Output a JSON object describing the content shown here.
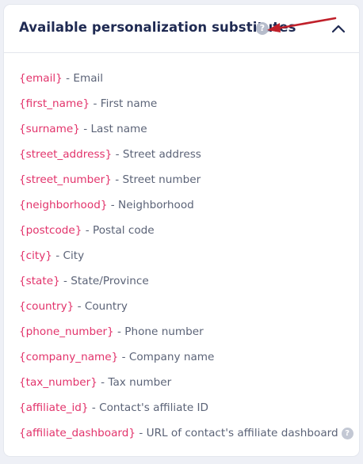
{
  "panel": {
    "title": "Available personalization substitutes",
    "help_glyph": "?",
    "toggle_icon": "chevron-up-icon",
    "annotation_color": "#c0202a"
  },
  "items": [
    {
      "token": "{email}",
      "separator": " - ",
      "description": "Email"
    },
    {
      "token": "{first_name}",
      "separator": " - ",
      "description": "First name"
    },
    {
      "token": "{surname}",
      "separator": " - ",
      "description": "Last name"
    },
    {
      "token": "{street_address}",
      "separator": " - ",
      "description": "Street address"
    },
    {
      "token": "{street_number}",
      "separator": " - ",
      "description": "Street number"
    },
    {
      "token": "{neighborhood}",
      "separator": " - ",
      "description": "Neighborhood"
    },
    {
      "token": "{postcode}",
      "separator": " - ",
      "description": "Postal code"
    },
    {
      "token": "{city}",
      "separator": " - ",
      "description": "City"
    },
    {
      "token": "{state}",
      "separator": " - ",
      "description": "State/Province"
    },
    {
      "token": "{country}",
      "separator": " - ",
      "description": "Country"
    },
    {
      "token": "{phone_number}",
      "separator": " - ",
      "description": "Phone number"
    },
    {
      "token": "{company_name}",
      "separator": " - ",
      "description": "Company name"
    },
    {
      "token": "{tax_number}",
      "separator": " - ",
      "description": "Tax number"
    },
    {
      "token": "{affiliate_id}",
      "separator": " - ",
      "description": "Contact's affiliate ID"
    },
    {
      "token": "{affiliate_dashboard}",
      "separator": " - ",
      "description": "URL of contact's affiliate dashboard"
    }
  ],
  "colors": {
    "token": "#e2336b",
    "title": "#1f2a52",
    "description": "#5b6377",
    "help_icon": "#b6bccb"
  }
}
